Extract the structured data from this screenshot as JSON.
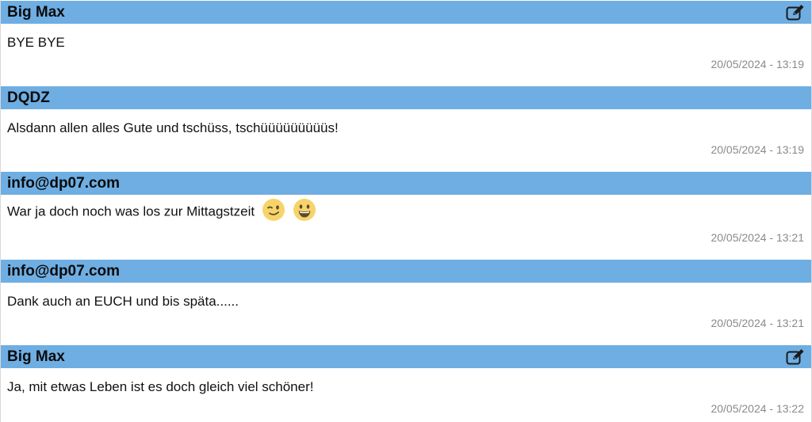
{
  "messages": [
    {
      "author": "Big Max",
      "text": "BYE BYE",
      "timestamp": "20/05/2024 - 13:19",
      "editable": true,
      "emojis": []
    },
    {
      "author": "DQDZ",
      "text": "Alsdann allen alles Gute und tschüss, tschüüüüüüüüüs!",
      "timestamp": "20/05/2024 - 13:19",
      "editable": false,
      "emojis": []
    },
    {
      "author": "info@dp07.com",
      "text": "War ja doch noch was los zur Mittagstzeit",
      "timestamp": "20/05/2024 - 13:21",
      "editable": false,
      "emojis": [
        "winking-face-emoji",
        "grinning-face-emoji"
      ]
    },
    {
      "author": "info@dp07.com",
      "text": "Dank auch an EUCH und bis späta......",
      "timestamp": "20/05/2024 - 13:21",
      "editable": false,
      "emojis": []
    },
    {
      "author": "Big Max",
      "text": "Ja, mit etwas Leben ist es doch gleich viel schöner!",
      "timestamp": "20/05/2024 - 13:22",
      "editable": true,
      "emojis": []
    }
  ],
  "colors": {
    "header_bg": "#6eaee3",
    "timestamp": "#8a8a8a",
    "accent_border": "#e07b62",
    "emoji_face": "#f7d46a"
  },
  "icons": {
    "edit": "edit-icon"
  }
}
